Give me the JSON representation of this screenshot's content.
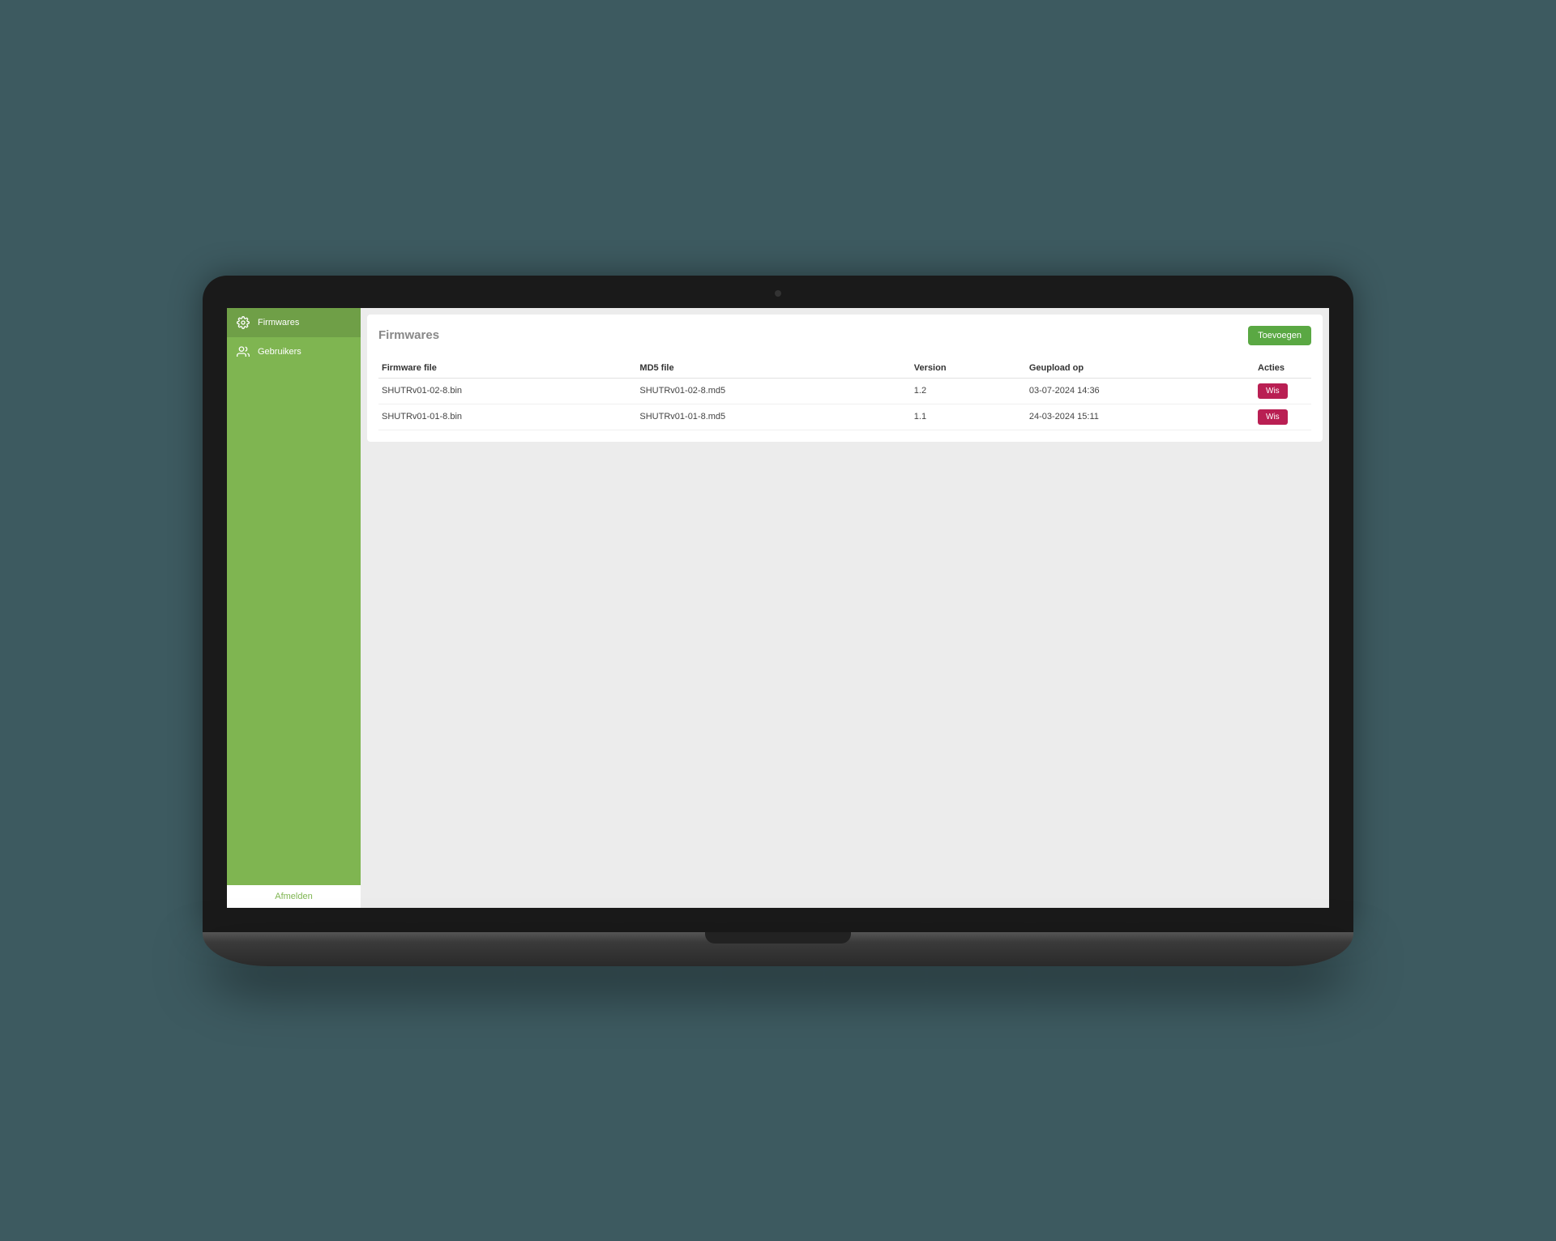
{
  "sidebar": {
    "items": [
      {
        "label": "Firmwares",
        "icon": "gear-icon",
        "active": true
      },
      {
        "label": "Gebruikers",
        "icon": "users-icon",
        "active": false
      }
    ],
    "logout_label": "Afmelden"
  },
  "panel": {
    "title": "Firmwares",
    "add_label": "Toevoegen"
  },
  "table": {
    "headers": {
      "firmware_file": "Firmware file",
      "md5_file": "MD5 file",
      "version": "Version",
      "uploaded_on": "Geupload op",
      "actions": "Acties"
    },
    "rows": [
      {
        "firmware_file": "SHUTRv01-02-8.bin",
        "md5_file": "SHUTRv01-02-8.md5",
        "version": "1.2",
        "uploaded_on": "03-07-2024 14:36",
        "delete_label": "Wis"
      },
      {
        "firmware_file": "SHUTRv01-01-8.bin",
        "md5_file": "SHUTRv01-01-8.md5",
        "version": "1.1",
        "uploaded_on": "24-03-2024 15:11",
        "delete_label": "Wis"
      }
    ]
  },
  "colors": {
    "sidebar_bg": "#7fb551",
    "sidebar_active": "#6f9f47",
    "accent_green": "#5aa843",
    "danger": "#b91f53"
  }
}
